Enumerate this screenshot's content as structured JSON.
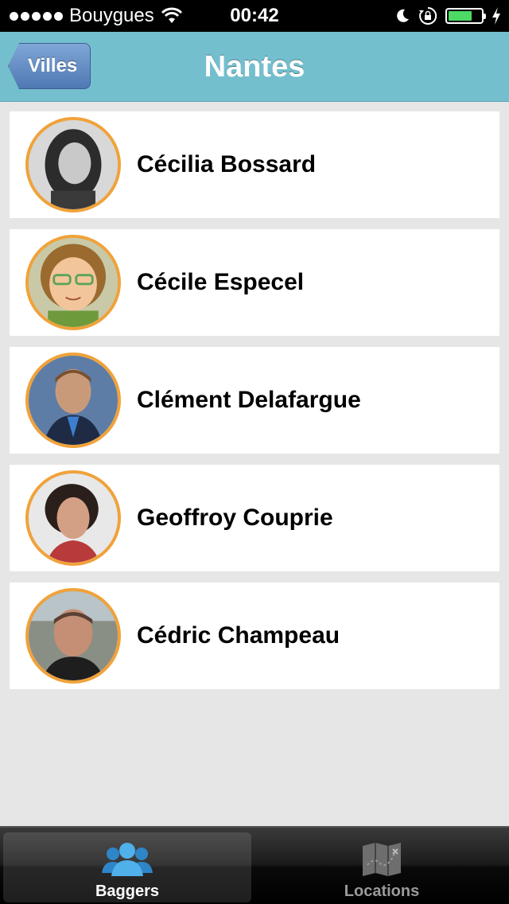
{
  "status_bar": {
    "carrier": "Bouygues",
    "time": "00:42",
    "battery_level": 0.72
  },
  "nav": {
    "back_label": "Villes",
    "title": "Nantes"
  },
  "people": [
    {
      "name": "Cécilia Bossard"
    },
    {
      "name": "Cécile Especel"
    },
    {
      "name": "Clément Delafargue"
    },
    {
      "name": "Geoffroy Couprie"
    },
    {
      "name": "Cédric Champeau"
    }
  ],
  "tabs": [
    {
      "label": "Baggers",
      "icon": "people-icon",
      "selected": true
    },
    {
      "label": "Locations",
      "icon": "map-icon",
      "selected": false
    }
  ],
  "colors": {
    "nav_bar": "#74bfce",
    "avatar_border": "#f0a23a",
    "back_button": "#5b84bf",
    "battery": "#4cd964",
    "selected_tab_icon": "#3aa0e0"
  }
}
